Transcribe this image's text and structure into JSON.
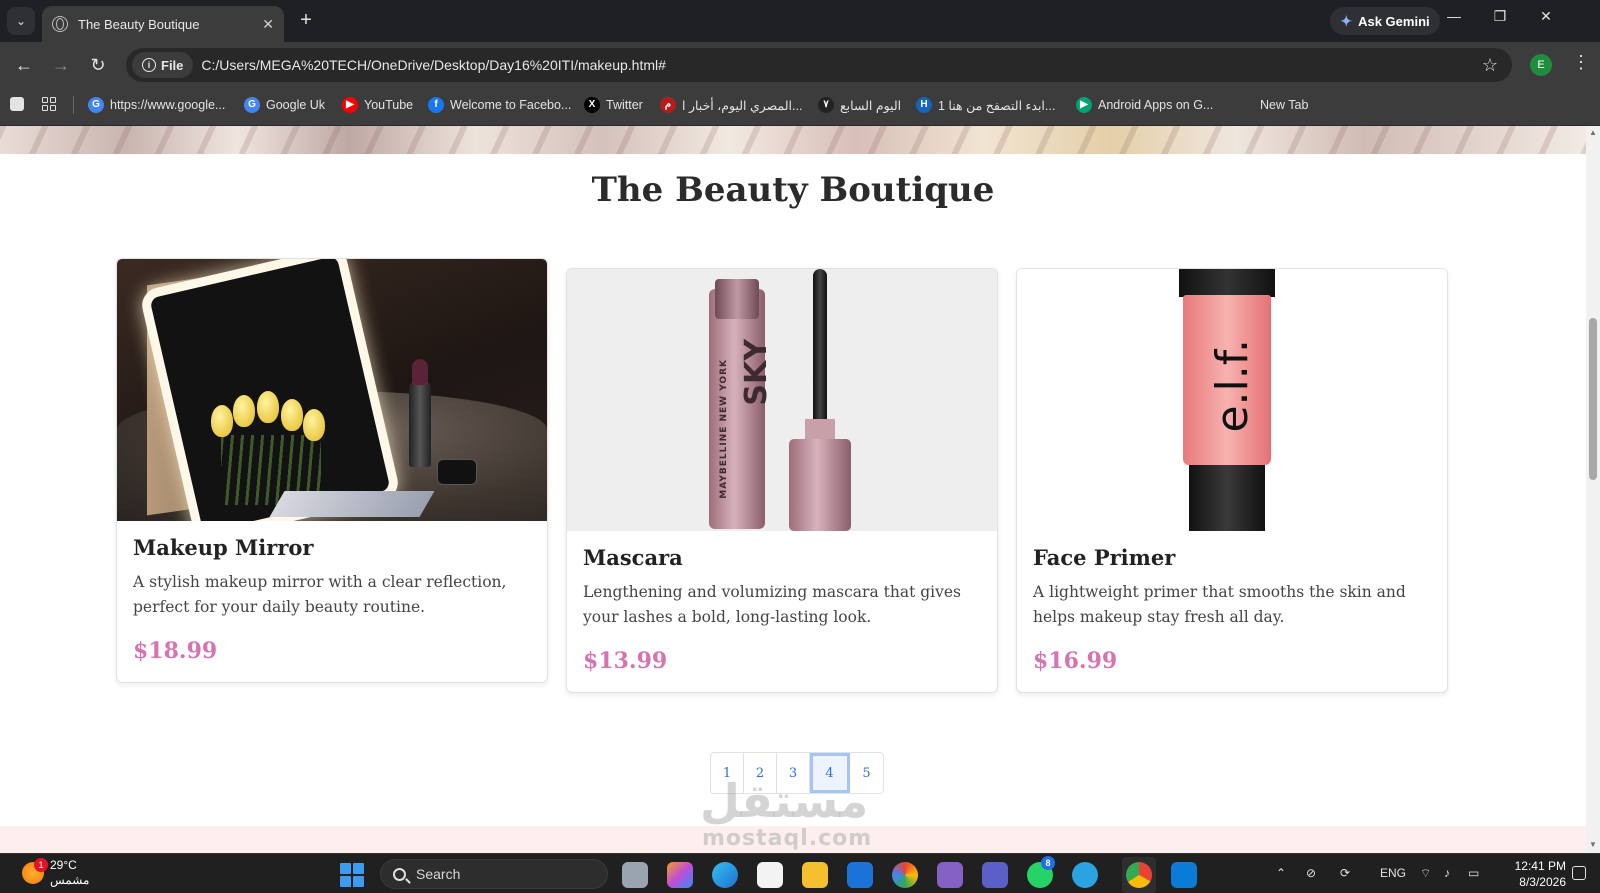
{
  "browser": {
    "tab": {
      "title": "The Beauty Boutique",
      "close": "✕"
    },
    "new_tab": "+",
    "gemini": {
      "label": "Ask Gemini",
      "icon": "✦"
    },
    "window_controls": {
      "minimize": "—",
      "restore": "❐",
      "close": "✕"
    },
    "nav": {
      "back": "←",
      "forward": "→",
      "reload": "↻"
    },
    "address": {
      "chip": "File",
      "url": "C:/Users/MEGA%20TECH/OneDrive/Desktop/Day16%20ITI/makeup.html#"
    },
    "bookmark_star": "☆",
    "profile_initial": "E",
    "menu": "⋮",
    "bookmarks": [
      {
        "label": "https://www.google...",
        "icon": "G",
        "color": "#4285f4"
      },
      {
        "label": "Google Uk",
        "icon": "G",
        "color": "#4285f4"
      },
      {
        "label": "YouTube",
        "icon": "▶",
        "color": "#ff0000"
      },
      {
        "label": "Welcome to Facebo...",
        "icon": "f",
        "color": "#1877f2"
      },
      {
        "label": "Twitter",
        "icon": "X",
        "color": "#000000"
      },
      {
        "label": "المصري اليوم، أخبار ا...",
        "icon": "م",
        "color": "#b71c1c"
      },
      {
        "label": "اليوم السابع",
        "icon": "٧",
        "color": "#222222"
      },
      {
        "label": "ابدء التصفح من هنا 1...",
        "icon": "H",
        "color": "#1565c0"
      },
      {
        "label": "Android Apps on G...",
        "icon": "▶",
        "color": "#00a173"
      },
      {
        "label": "New Tab",
        "icon": "",
        "color": "#3c3c3c"
      }
    ]
  },
  "page": {
    "title": "The Beauty Boutique",
    "products": [
      {
        "name": "Makeup Mirror",
        "description": "A stylish makeup mirror with a clear reflection, perfect for your daily beauty routine.",
        "price": "$18.99"
      },
      {
        "name": "Mascara",
        "description": "Lengthening and volumizing mascara that gives your lashes a bold, long-lasting look.",
        "price": "$13.99"
      },
      {
        "name": "Face Primer",
        "description": "A lightweight primer that smooths the skin and helps makeup stay fresh all day.",
        "price": "$16.99"
      }
    ],
    "mascara_text": {
      "brand": "MAYBELLINE NEW YORK",
      "sky": "SKY"
    },
    "primer_logo": "e.l.f.",
    "pagination": {
      "pages": [
        "1",
        "2",
        "3",
        "4",
        "5"
      ],
      "active": "4"
    },
    "watermark": {
      "line1": "مستقل",
      "line2": "mostaql.com"
    },
    "colors": {
      "price": "#d774b0",
      "link": "#2f6fd0"
    }
  },
  "taskbar": {
    "weather": {
      "temp": "29°C",
      "condition": "مشمس",
      "badge": "1"
    },
    "search_placeholder": "Search",
    "language": "ENG",
    "time": "12:41 PM",
    "date": "8/3/2026",
    "whatsapp_badge": "8"
  }
}
